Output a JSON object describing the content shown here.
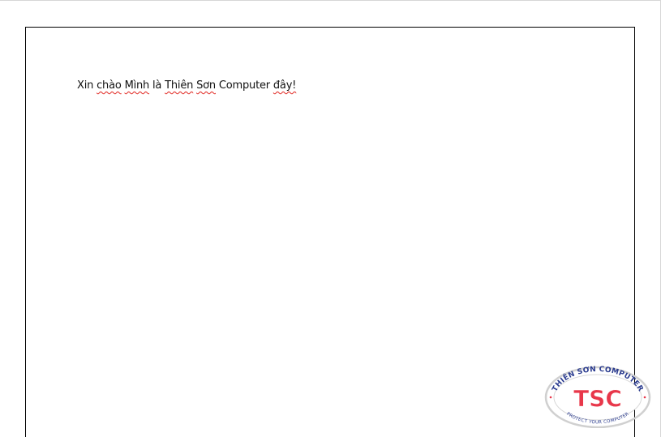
{
  "document": {
    "body_words": [
      {
        "text": "Xin",
        "misspelled": false
      },
      {
        "text": "chào",
        "misspelled": true
      },
      {
        "text": "Mình",
        "misspelled": true
      },
      {
        "text": "là",
        "misspelled": false
      },
      {
        "text": "Thiên",
        "misspelled": true
      },
      {
        "text": "Sơn",
        "misspelled": true
      },
      {
        "text": "Computer",
        "misspelled": false
      },
      {
        "text": "đây!",
        "misspelled": true
      }
    ]
  },
  "watermark": {
    "name": "TSC",
    "arc_top": "THIÊN SƠN COMPUTER",
    "arc_bottom": "PROTECT YOUR COMPUTER",
    "colors": {
      "ring": "#c8c8c8",
      "text_red": "#e8374a",
      "arc_blue": "#2a3b8f"
    }
  },
  "colors": {
    "page_border": "#000000",
    "spellcheck_underline": "#e0201a"
  }
}
